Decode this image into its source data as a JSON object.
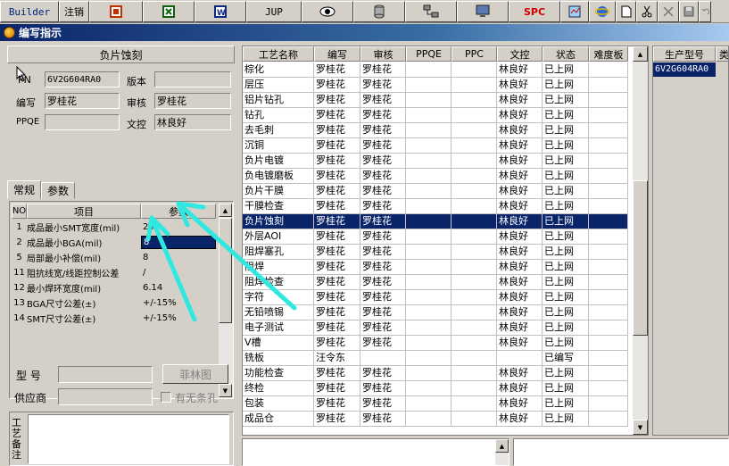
{
  "toolbar": {
    "builder_label": "Builder",
    "logout_label": "注销",
    "jup_label": "JUP",
    "spc_label": "SPC",
    "icons": [
      "form-icon",
      "excel-icon",
      "word-icon",
      "eye-icon",
      "database-icon",
      "network-icon",
      "monitor-icon",
      "report-icon",
      "ie-icon",
      "new-doc-icon",
      "cut-icon",
      "close-icon",
      "save-icon",
      "undo-icon"
    ]
  },
  "window": {
    "title": "编写指示"
  },
  "left": {
    "process_header": "负片蚀刻",
    "fields": {
      "pn_label": "PN",
      "pn_value": "6V2G604RA0",
      "version_label": "版本",
      "version_value": "",
      "writer_label": "编写",
      "writer_value": "罗桂花",
      "reviewer_label": "审核",
      "reviewer_value": "罗桂花",
      "ppqe_label": "PPQE",
      "ppqe_value": "",
      "doc_ctrl_label": "文控",
      "doc_ctrl_value": "林良好"
    },
    "tabs": [
      "常规",
      "参数"
    ],
    "param_grid": {
      "headers": [
        "NO",
        "项目",
        "参数"
      ],
      "rows": [
        {
          "no": "1",
          "item": "成品最小SMT宽度(mil)",
          "value": "24"
        },
        {
          "no": "2",
          "item": "成品最小BGA(mil)",
          "value": "8"
        },
        {
          "no": "5",
          "item": "局部最小补偿(mil)",
          "value": "8"
        },
        {
          "no": "11",
          "item": "阻抗线宽/线距控制公差",
          "value": "/"
        },
        {
          "no": "12",
          "item": "最小焊环宽度(mil)",
          "value": "6.14"
        },
        {
          "no": "13",
          "item": "BGA尺寸公差(±)",
          "value": "+/-15%"
        },
        {
          "no": "14",
          "item": "SMT尺寸公差(±)",
          "value": "+/-15%"
        }
      ]
    },
    "model_label": "型  号",
    "model_value": "",
    "film_button": "菲林图",
    "supplier_label": "供应商",
    "supplier_value": "",
    "barcode_label": "有无条孔",
    "remark_label": "工艺备注"
  },
  "main_grid": {
    "headers": [
      "工艺名称",
      "编写",
      "审核",
      "PPQE",
      "PPC",
      "文控",
      "状态",
      "难度板"
    ],
    "selected_index": 10,
    "rows": [
      [
        "棕化",
        "罗桂花",
        "罗桂花",
        "",
        "",
        "林良好",
        "已上网",
        ""
      ],
      [
        "层压",
        "罗桂花",
        "罗桂花",
        "",
        "",
        "林良好",
        "已上网",
        ""
      ],
      [
        "铝片钻孔",
        "罗桂花",
        "罗桂花",
        "",
        "",
        "林良好",
        "已上网",
        ""
      ],
      [
        "钻孔",
        "罗桂花",
        "罗桂花",
        "",
        "",
        "林良好",
        "已上网",
        ""
      ],
      [
        "去毛刺",
        "罗桂花",
        "罗桂花",
        "",
        "",
        "林良好",
        "已上网",
        ""
      ],
      [
        "沉铜",
        "罗桂花",
        "罗桂花",
        "",
        "",
        "林良好",
        "已上网",
        ""
      ],
      [
        "负片电镀",
        "罗桂花",
        "罗桂花",
        "",
        "",
        "林良好",
        "已上网",
        ""
      ],
      [
        "负电镀磨板",
        "罗桂花",
        "罗桂花",
        "",
        "",
        "林良好",
        "已上网",
        ""
      ],
      [
        "负片干膜",
        "罗桂花",
        "罗桂花",
        "",
        "",
        "林良好",
        "已上网",
        ""
      ],
      [
        "干膜检查",
        "罗桂花",
        "罗桂花",
        "",
        "",
        "林良好",
        "已上网",
        ""
      ],
      [
        "负片蚀刻",
        "罗桂花",
        "罗桂花",
        "",
        "",
        "林良好",
        "已上网",
        ""
      ],
      [
        "外层AOI",
        "罗桂花",
        "罗桂花",
        "",
        "",
        "林良好",
        "已上网",
        ""
      ],
      [
        "阻焊塞孔",
        "罗桂花",
        "罗桂花",
        "",
        "",
        "林良好",
        "已上网",
        ""
      ],
      [
        "阻焊",
        "罗桂花",
        "罗桂花",
        "",
        "",
        "林良好",
        "已上网",
        ""
      ],
      [
        "阻焊检查",
        "罗桂花",
        "罗桂花",
        "",
        "",
        "林良好",
        "已上网",
        ""
      ],
      [
        "字符",
        "罗桂花",
        "罗桂花",
        "",
        "",
        "林良好",
        "已上网",
        ""
      ],
      [
        "无铅喷锡",
        "罗桂花",
        "罗桂花",
        "",
        "",
        "林良好",
        "已上网",
        ""
      ],
      [
        "电子测试",
        "罗桂花",
        "罗桂花",
        "",
        "",
        "林良好",
        "已上网",
        ""
      ],
      [
        "V槽",
        "罗桂花",
        "罗桂花",
        "",
        "",
        "林良好",
        "已上网",
        ""
      ],
      [
        "铣板",
        "汪令东",
        "",
        "",
        "",
        "",
        "已编写",
        ""
      ],
      [
        "功能检查",
        "罗桂花",
        "罗桂花",
        "",
        "",
        "林良好",
        "已上网",
        ""
      ],
      [
        "终检",
        "罗桂花",
        "罗桂花",
        "",
        "",
        "林良好",
        "已上网",
        ""
      ],
      [
        "包装",
        "罗桂花",
        "罗桂花",
        "",
        "",
        "林良好",
        "已上网",
        ""
      ],
      [
        "成品仓",
        "罗桂花",
        "罗桂花",
        "",
        "",
        "林良好",
        "已上网",
        ""
      ]
    ]
  },
  "right_grid": {
    "headers": [
      "生产型号",
      "类型"
    ],
    "rows": [
      [
        "6V2G604RA0"
      ]
    ]
  },
  "colors": {
    "selection": "#0a246a",
    "arrow": "#30e8e0",
    "face": "#d4d0c8"
  }
}
